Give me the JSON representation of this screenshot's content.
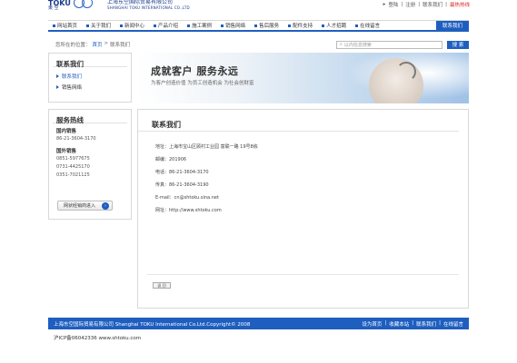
{
  "header": {
    "logo_text": "TOKU",
    "logo_sub": "東 空",
    "company_cn": "上海东空国际贸易有限公司",
    "company_en": "SHANGHAI TOKU INTERNATIONAL CO.,LTD",
    "top_links": [
      "登陆",
      "注册",
      "联系我们"
    ],
    "top_hot": "最热热线",
    "separator": "|"
  },
  "nav": {
    "items": [
      "网站首页",
      "关于我们",
      "新闻中心",
      "产品介绍",
      "施工案例",
      "销售网络",
      "售后服务",
      "配件支持",
      "人才招聘",
      "在线留言"
    ],
    "active": "联系我们"
  },
  "breadcrumb": {
    "prefix": "您所在的位置：",
    "home": "首页",
    "sep": ">",
    "current": "联系我们"
  },
  "search": {
    "placeholder": "以内信息搜索",
    "button": "搜 索"
  },
  "sidebar": {
    "contact_title": "联系我们",
    "menu": [
      {
        "label": "联系我们",
        "active": true
      },
      {
        "label": "销售网络",
        "active": false
      }
    ],
    "hotline_title": "服务热线",
    "hotlines": [
      {
        "label": "国内销售",
        "numbers": [
          "86-21-3604-3170"
        ]
      },
      {
        "label": "国外销售",
        "numbers": [
          "0851-5977675",
          "0731-4425170",
          "0351-7021125"
        ]
      }
    ],
    "agent_button": "网状经销商进入"
  },
  "banner": {
    "title": "成就客户  服务永远",
    "subtitle": "为客户创造价值 为员工创造机会 为社会创财富"
  },
  "main": {
    "title": "联系我们",
    "lines": [
      "地址：上海市宝山区顾村工业园 富联一路 19号8栋",
      "邮编：201906",
      "电话：86-21-3604-3170",
      "传真：86-21-3604-3190",
      "E-mail：cn@shtoku.sina.net",
      "网址：http://www.shtoku.com"
    ],
    "back_button": "返 回"
  },
  "footer": {
    "copyright": "上海东空国际贸易有限公司 Shanghai TOKU International Co.Ltd.Copyright© 2008",
    "links": [
      "设为首页",
      "|",
      "收藏本站",
      "|",
      "联系我们",
      "|",
      "在线留言"
    ],
    "icp": "沪ICP备06042336  www.shtoku.com"
  },
  "colors": {
    "accent": "#1e5ebf",
    "hot": "#dd2222"
  }
}
